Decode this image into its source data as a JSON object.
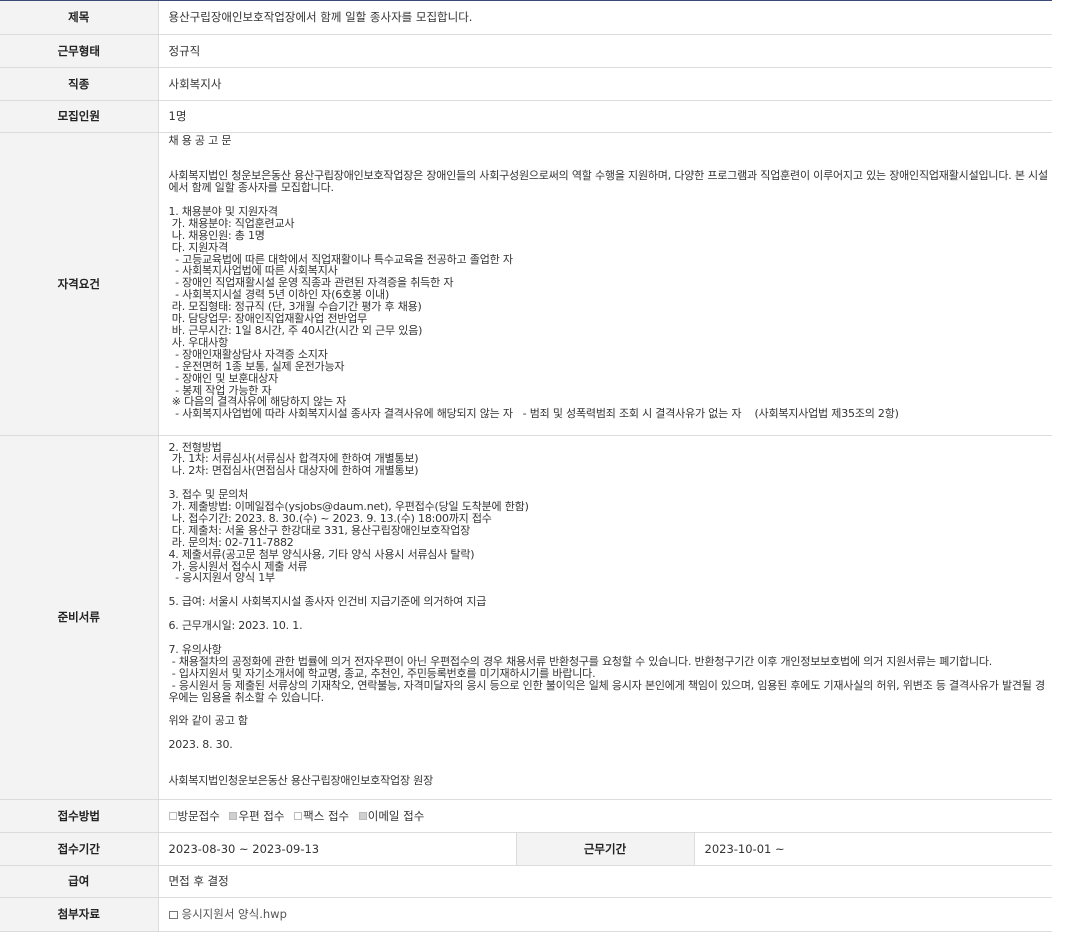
{
  "rows": {
    "title": {
      "label": "제목",
      "value": "용산구립장애인보호작업장에서 함께 일할 종사자를 모집합니다."
    },
    "work_type": {
      "label": "근무형태",
      "value": "정규직"
    },
    "occupation": {
      "label": "직종",
      "value": "사회복지사"
    },
    "headcount": {
      "label": "모집인원",
      "value": "1명"
    },
    "qualification": {
      "label": "자격요건",
      "text": "채 용 공 고 문\n\n\n사회복지법인 청운보은동산 용산구립장애인보호작업장은 장애인들의 사회구성원으로써의 역할 수행을 지원하며, 다양한 프로그램과 직업훈련이 이루어지고 있는 장애인직업재활시설입니다. 본 시설에서 함께 일할 종사자를 모집합니다.\n\n1. 채용분야 및 지원자격\n 가. 채용분야: 직업훈련교사\n 나. 채용인원: 총 1명\n 다. 지원자격\n  - 고등교육법에 따른 대학에서 직업재활이나 특수교육을 전공하고 졸업한 자\n  - 사회복지사업법에 따른 사회복지사\n  - 장애인 직업재활시설 운영 직종과 관련된 자격증을 취득한 자\n  - 사회복지시설 경력 5년 이하인 자(6호봉 이내)\n 라. 모집형태: 정규직 (단, 3개월 수습기간 평가 후 채용)\n 마. 담당업무: 장애인직업재활사업 전반업무\n 바. 근무시간: 1일 8시간, 주 40시간(시간 외 근무 있음)\n 사. 우대사항\n  - 장애인재활상담사 자격증 소지자\n  - 운전면허 1종 보통, 실제 운전가능자\n  - 장애인 및 보훈대상자\n  - 봉제 작업 가능한 자\n ※ 다음의 결격사유에 해당하지 않는 자\n  - 사회복지사업법에 따라 사회복지시설 종사자 결격사유에 해당되지 않는 자   - 범죄 및 성폭력범죄 조회 시 결격사유가 없는 자    (사회복지사업법 제35조의 2항)"
    },
    "documents": {
      "label": "준비서류",
      "text": "2. 전형방법\n 가. 1차: 서류심사(서류심사 합격자에 한하여 개별통보)\n 나. 2차: 면접심사(면접심사 대상자에 한하여 개별통보)\n\n3. 접수 및 문의처\n 가. 제출방법: 이메일접수(ysjobs@daum.net), 우편접수(당일 도착분에 한함)\n 나. 접수기간: 2023. 8. 30.(수) ~ 2023. 9. 13.(수) 18:00까지 접수\n 다. 제출처: 서울 용산구 한강대로 331, 용산구립장애인보호작업장\n 라. 문의처: 02-711-7882\n4. 제출서류(공고문 첨부 양식사용, 기타 양식 사용시 서류심사 탈락)\n 가. 응시원서 접수시 제출 서류\n  - 응시지원서 양식 1부\n\n5. 급여: 서울시 사회복지시설 종사자 인건비 지급기준에 의거하여 지급\n\n6. 근무개시일: 2023. 10. 1.\n\n7. 유의사항\n - 채용절차의 공정화에 관한 법률에 의거 전자우편이 아닌 우편접수의 경우 채용서류 반환청구를 요청할 수 있습니다. 반환청구기간 이후 개인정보보호법에 의거 지원서류는 폐기합니다.\n - 입사지원서 및 자기소개서에 학교명, 종교, 추천인, 주민등록번호를 미기재하시기를 바랍니다.\n - 응시원서 등 제출된 서류상의 기재착오, 연락불능, 자격미달자의 응시 등으로 인한 불이익은 일체 응시자 본인에게 책임이 있으며, 임용된 후에도 기재사실의 허위, 위변조 등 결격사유가 발견될 경우에는 임용을 취소할 수 있습니다.\n\n위와 같이 공고 함\n\n2023. 8. 30.\n\n\n사회복지법인청운보은동산 용산구립장애인보호작업장 원장"
    },
    "method": {
      "label": "접수방법",
      "options": [
        {
          "label": "방문접수",
          "checked": false
        },
        {
          "label": "우편 접수",
          "checked": true
        },
        {
          "label": "팩스 접수",
          "checked": false
        },
        {
          "label": "이메일 접수",
          "checked": true
        }
      ]
    },
    "period": {
      "label": "접수기간",
      "value": "2023-08-30 ~ 2023-09-13",
      "label2": "근무기간",
      "value2": "2023-10-01 ~"
    },
    "salary": {
      "label": "급여",
      "value": "면접 후 결정"
    },
    "attachment": {
      "label": "첨부자료",
      "file": "응시지원서 양식.hwp",
      "icon": "file-icon"
    }
  }
}
